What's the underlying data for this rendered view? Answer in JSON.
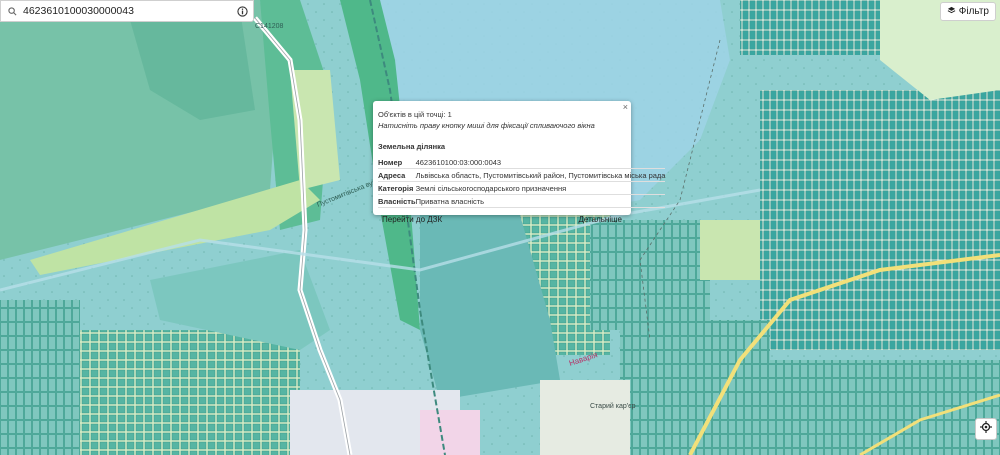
{
  "search": {
    "value": "4623610100030000043"
  },
  "filter": {
    "label": "Фільтр"
  },
  "popup": {
    "objects_line": "Об'єктів в цій точці: 1",
    "hint": "Натисніть праву кнопку миші для фіксації спливаючого вікна",
    "section_title": "Земельна ділянка",
    "rows": [
      {
        "key": "Номер",
        "value": "4623610100:03:000:0043"
      },
      {
        "key": "Адреса",
        "value": "Львівська область, Пустомитівський район, Пустомитівська міська рада"
      },
      {
        "key": "Категорія",
        "value": "Землі сільськогосподарського призначення"
      },
      {
        "key": "Власність",
        "value": "Приватна власність"
      }
    ],
    "action_dzk": "Перейти до ДЗК",
    "action_details": "Детальніше",
    "close": "×"
  },
  "map_labels": {
    "road_code": "C141208",
    "street_pustomytivska": "Пустомитівська вул.",
    "street_naviriya": "Наварія",
    "quarry": "Старий кар'єр"
  },
  "colors": {
    "base_teal": "#8fcfd0",
    "water_blue": "#9fd3e6",
    "forest_green": "#6fc3a3",
    "field_light": "#c9e6b0",
    "parcel_dark": "#3f9f8f",
    "road_yellow": "#f2e07a"
  }
}
